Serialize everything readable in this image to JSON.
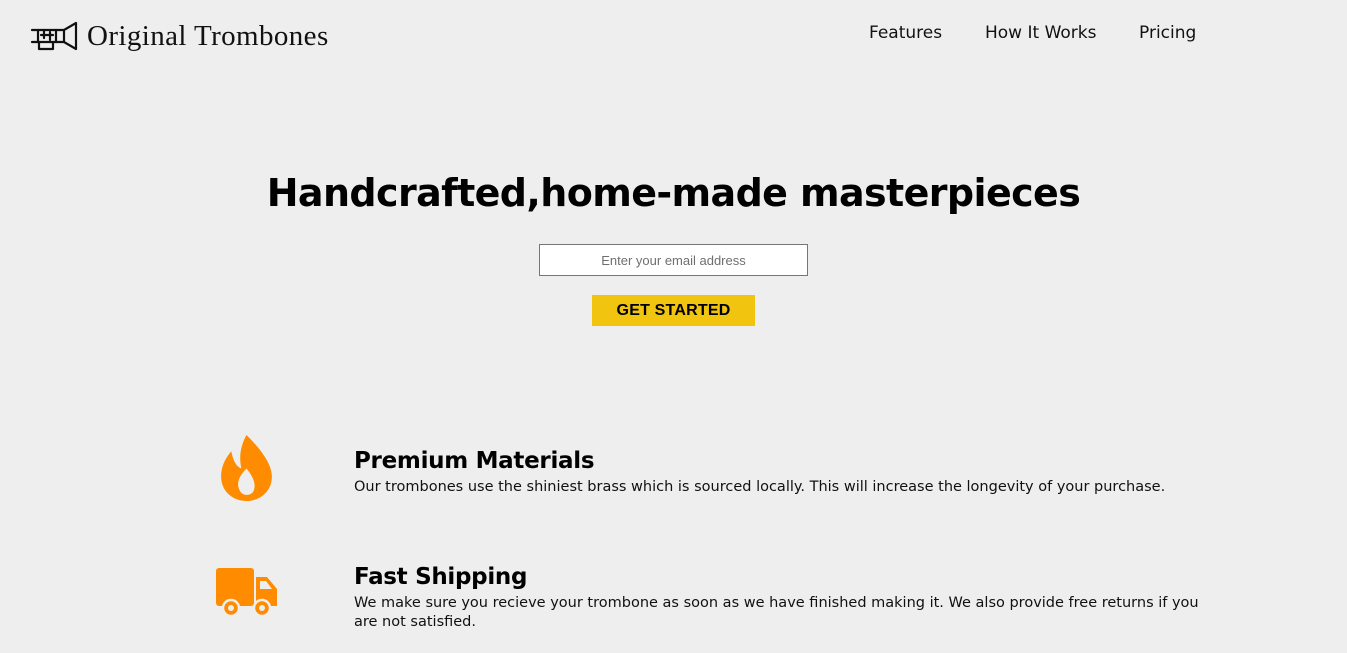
{
  "brand": {
    "name": "Original Trombones",
    "logo_icon": "trombone-icon"
  },
  "nav": {
    "links": [
      {
        "label": "Features"
      },
      {
        "label": "How It Works"
      },
      {
        "label": "Pricing"
      }
    ]
  },
  "hero": {
    "title": "Handcrafted,home-made masterpieces",
    "email_placeholder": "Enter your email address",
    "email_value": "",
    "cta_label": "GET STARTED"
  },
  "colors": {
    "background": "#eeeeee",
    "cta": "#f1c40f",
    "icon_accent": "#ff8c00"
  },
  "features": [
    {
      "icon": "fire-icon",
      "title": "Premium Materials",
      "description": "Our trombones use the shiniest brass which is sourced locally. This will increase the longevity of your purchase."
    },
    {
      "icon": "truck-icon",
      "title": "Fast Shipping",
      "description": "We make sure you recieve your trombone as soon as we have finished making it. We also provide free returns if you are not satisfied."
    }
  ]
}
